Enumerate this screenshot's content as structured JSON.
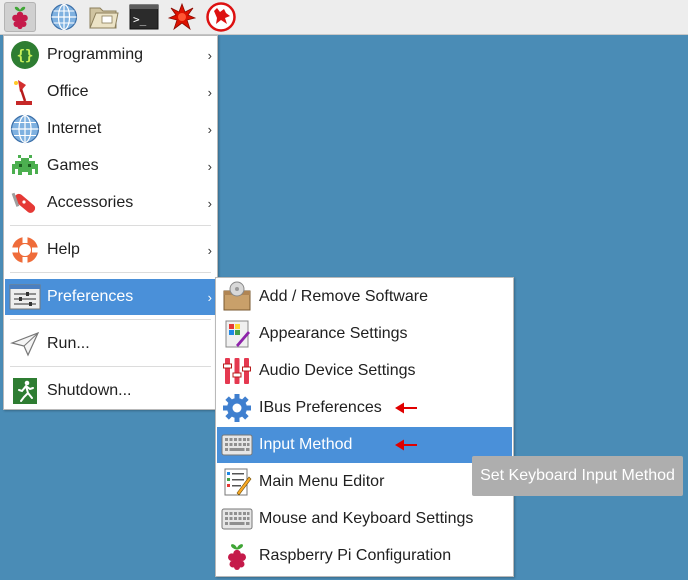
{
  "taskbar": {
    "items": [
      {
        "name": "raspberry-menu-icon"
      },
      {
        "name": "web-browser-icon"
      },
      {
        "name": "file-manager-icon"
      },
      {
        "name": "terminal-icon"
      },
      {
        "name": "mathematica-icon"
      },
      {
        "name": "wolfram-icon"
      }
    ]
  },
  "main_menu": {
    "items": [
      {
        "label": "Programming",
        "icon": "programming-icon",
        "submenu": true
      },
      {
        "label": "Office",
        "icon": "office-icon",
        "submenu": true
      },
      {
        "label": "Internet",
        "icon": "internet-icon",
        "submenu": true
      },
      {
        "label": "Games",
        "icon": "games-icon",
        "submenu": true
      },
      {
        "label": "Accessories",
        "icon": "accessories-icon",
        "submenu": true
      },
      {
        "label": "Help",
        "icon": "help-icon",
        "submenu": true
      },
      {
        "label": "Preferences",
        "icon": "preferences-icon",
        "submenu": true,
        "selected": true
      },
      {
        "label": "Run...",
        "icon": "run-icon",
        "submenu": false
      },
      {
        "label": "Shutdown...",
        "icon": "shutdown-icon",
        "submenu": false
      }
    ],
    "submenu_arrow": "›"
  },
  "preferences_menu": {
    "items": [
      {
        "label": "Add / Remove Software",
        "icon": "package-icon"
      },
      {
        "label": "Appearance Settings",
        "icon": "appearance-icon"
      },
      {
        "label": "Audio Device Settings",
        "icon": "audio-mixer-icon"
      },
      {
        "label": "IBus Preferences",
        "icon": "ibus-gear-icon",
        "annotated": true
      },
      {
        "label": "Input Method",
        "icon": "keyboard-icon",
        "selected": true,
        "annotated": true
      },
      {
        "label": "Main Menu Editor",
        "icon": "menu-editor-icon"
      },
      {
        "label": "Mouse and Keyboard Settings",
        "icon": "keyboard-icon"
      },
      {
        "label": "Raspberry Pi Configuration",
        "icon": "raspberry-icon"
      }
    ]
  },
  "tooltip": {
    "text": "Set Keyboard Input Method"
  },
  "colors": {
    "desktop": "#4a8cb6",
    "highlight": "#4a90d9",
    "annotation_arrow": "#e00000",
    "tooltip_bg": "#aeaeae"
  }
}
